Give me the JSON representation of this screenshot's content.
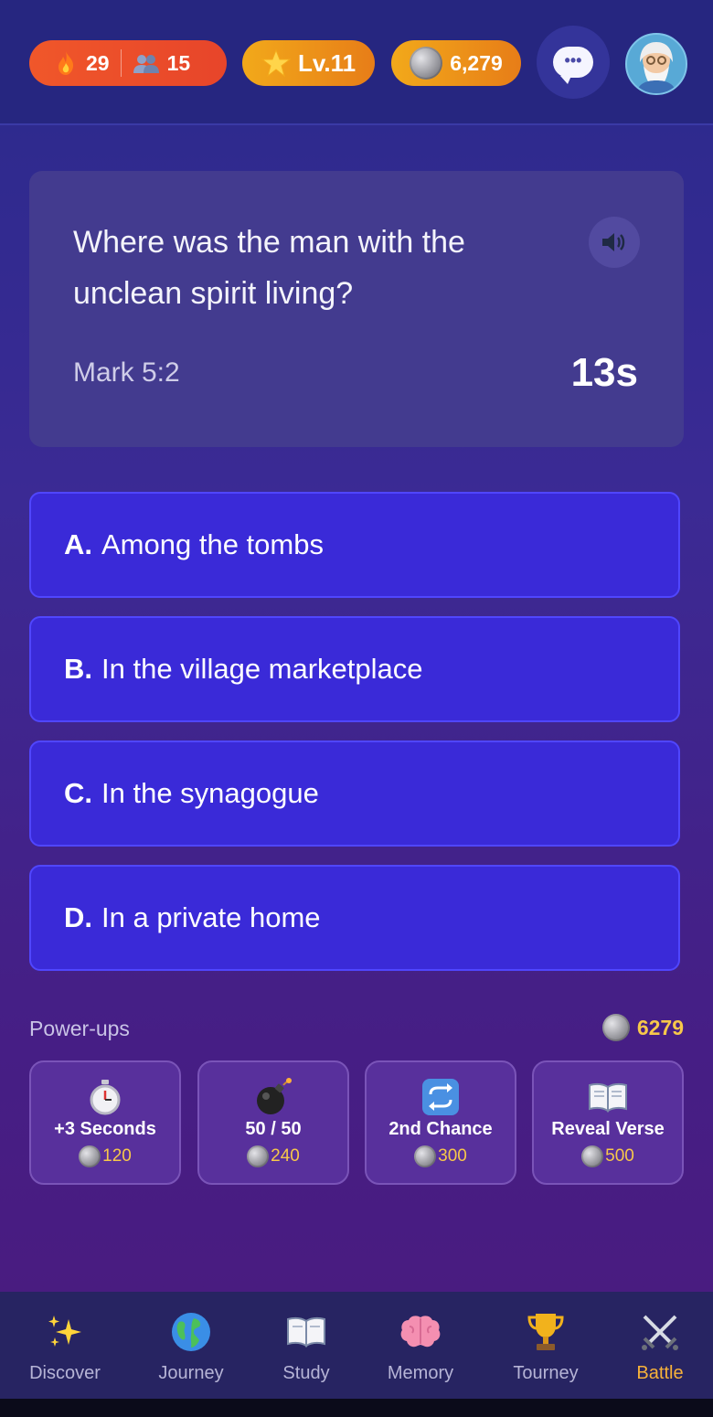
{
  "header": {
    "streak": "29",
    "friends": "15",
    "level": "Lv.11",
    "coins": "6,279"
  },
  "question": {
    "text": "Where was the man with the unclean spirit living?",
    "reference": "Mark 5:2",
    "timer": "13s"
  },
  "answers": [
    {
      "letter": "A.",
      "text": "Among the tombs"
    },
    {
      "letter": "B.",
      "text": "In the village marketplace"
    },
    {
      "letter": "C.",
      "text": "In the synagogue"
    },
    {
      "letter": "D.",
      "text": "In a private home"
    }
  ],
  "powerups": {
    "label": "Power-ups",
    "balance": "6279",
    "items": [
      {
        "name": "+3 Seconds",
        "cost": "120",
        "icon": "stopwatch-icon"
      },
      {
        "name": "50 / 50",
        "cost": "240",
        "icon": "bomb-icon"
      },
      {
        "name": "2nd Chance",
        "cost": "300",
        "icon": "repeat-icon"
      },
      {
        "name": "Reveal Verse",
        "cost": "500",
        "icon": "book-icon"
      }
    ]
  },
  "nav": {
    "items": [
      {
        "label": "Discover",
        "icon": "sparkles-icon"
      },
      {
        "label": "Journey",
        "icon": "globe-icon"
      },
      {
        "label": "Study",
        "icon": "book-icon"
      },
      {
        "label": "Memory",
        "icon": "brain-icon"
      },
      {
        "label": "Tourney",
        "icon": "trophy-icon"
      },
      {
        "label": "Battle",
        "icon": "crossed-swords-icon"
      }
    ],
    "active": "Battle"
  },
  "colors": {
    "answer_bg": "#3a2ad8",
    "accent_gold": "#f7c84a",
    "streak_pill": "#e7452a",
    "level_pill": "#e77d18"
  }
}
